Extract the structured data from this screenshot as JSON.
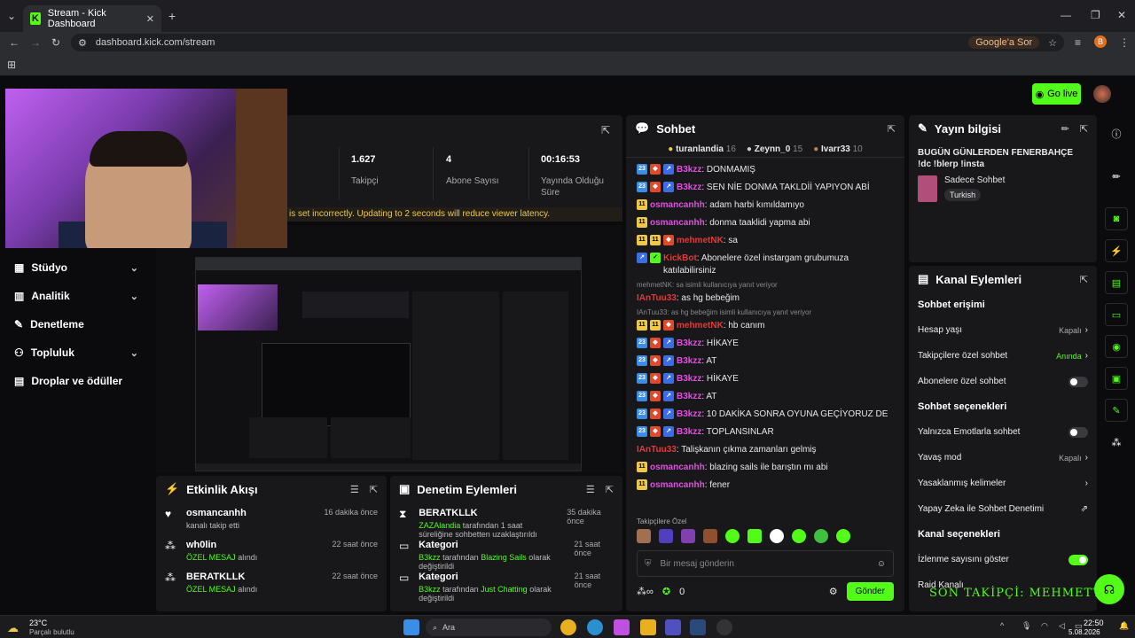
{
  "browser": {
    "tab_title": "Stream - Kick Dashboard",
    "url": "dashboard.kick.com/stream",
    "google_ask": "Google'a Sor",
    "profile_letter": "B"
  },
  "topbar": {
    "go_live": "Go live"
  },
  "stats": {
    "followers": "1.627",
    "followers_label": "Takipçi",
    "subs": "4",
    "subs_label": "Abone Sayısı",
    "uptime": "00:16:53",
    "uptime_label": "Yayında Olduğu Süre",
    "warning": "is set incorrectly. Updating to 2 seconds will reduce viewer latency."
  },
  "sidebar": {
    "items": [
      {
        "label": "Stüdyo"
      },
      {
        "label": "Analitik"
      },
      {
        "label": "Denetleme"
      },
      {
        "label": "Topluluk"
      },
      {
        "label": "Droplar ve ödüller"
      }
    ]
  },
  "activity": {
    "title": "Etkinlik Akışı",
    "events": [
      {
        "user": "osmancanhh",
        "desc": "kanalı takip etti",
        "time": "16 dakika önce"
      },
      {
        "user": "wh0lin",
        "desc_a": "ÖZEL MESAJ",
        "desc_b": "alındı",
        "time": "22 saat önce"
      },
      {
        "user": "BERATKLLK",
        "desc_a": "ÖZEL MESAJ",
        "desc_b": "alındı",
        "time": "22 saat önce"
      }
    ]
  },
  "moderation": {
    "title": "Denetim Eylemleri",
    "events": [
      {
        "user": "BERATKLLK",
        "actor": "ZAZAlandia",
        "desc": "tarafından 1 saat süreliğine sohbetten uzaklaştırıldı",
        "time": "35 dakika önce"
      },
      {
        "user": "Kategori",
        "actor": "B3kzz",
        "desc_a": "tarafından",
        "cat": "Blazing Sails",
        "desc_b": "olarak değiştirildi",
        "time": "21 saat önce"
      },
      {
        "user": "Kategori",
        "actor": "B3kzz",
        "desc_a": "tarafından",
        "cat": "Just Chatting",
        "desc_b": "olarak değiştirildi",
        "time": "21 saat önce"
      }
    ]
  },
  "chat": {
    "title": "Sohbet",
    "top_gifters": [
      {
        "name": "turanlandia",
        "count": "16"
      },
      {
        "name": "Zeynn_0",
        "count": "15"
      },
      {
        "name": "Ivarr33",
        "count": "10"
      }
    ],
    "messages": [
      {
        "user": "B3kzz",
        "color": "#e050e0",
        "text": "DONMAMIŞ",
        "badges": [
          "num",
          "mod",
          "vip"
        ]
      },
      {
        "user": "B3kzz",
        "color": "#e050e0",
        "text": "SEN NİE DONMA TAKLDİİ YAPIYON ABİ",
        "badges": [
          "num",
          "mod",
          "vip"
        ]
      },
      {
        "user": "osmancanhh",
        "color": "#e050e0",
        "text": "adam harbi kımıldamıyo",
        "badges": [
          "sub"
        ]
      },
      {
        "user": "osmancanhh",
        "color": "#e050e0",
        "text": "donma taaklidi yapma abi",
        "badges": [
          "sub"
        ]
      },
      {
        "user": "mehmetNK",
        "color": "#e03a3a",
        "text": "sa",
        "badges": [
          "sub",
          "sub",
          "mod"
        ]
      },
      {
        "user": "KickBot",
        "color": "#e03a3a",
        "text": "Abonelere özel instargam grubumuza katılabilirsiniz",
        "badges": [
          "vip",
          "og"
        ]
      },
      {
        "reply": "mehmetNK: sa isimli kullanıcıya yanıt veriyor",
        "user": "IAnTuu33",
        "color": "#e03a3a",
        "text": "as hg bebeğim",
        "badges": []
      },
      {
        "reply": "IAnTuu33: as hg bebeğim isimli kullanıcıya yanıt veriyor",
        "user": "mehmetNK",
        "color": "#e03a3a",
        "text": "hb canım",
        "badges": [
          "sub",
          "sub",
          "mod"
        ]
      },
      {
        "user": "B3kzz",
        "color": "#e050e0",
        "text": "HİKAYE",
        "badges": [
          "num",
          "mod",
          "vip"
        ]
      },
      {
        "user": "B3kzz",
        "color": "#e050e0",
        "text": "AT",
        "badges": [
          "num",
          "mod",
          "vip"
        ]
      },
      {
        "user": "B3kzz",
        "color": "#e050e0",
        "text": "HİKAYE",
        "badges": [
          "num",
          "mod",
          "vip"
        ]
      },
      {
        "user": "B3kzz",
        "color": "#e050e0",
        "text": "AT",
        "badges": [
          "num",
          "mod",
          "vip"
        ]
      },
      {
        "user": "B3kzz",
        "color": "#e050e0",
        "text": "10 DAKİKA SONRA OYUNA GEÇİYORUZ DE",
        "badges": [
          "num",
          "mod",
          "vip"
        ]
      },
      {
        "user": "B3kzz",
        "color": "#e050e0",
        "text": "TOPLANSINLAR",
        "badges": [
          "num",
          "mod",
          "vip"
        ]
      },
      {
        "user": "IAnTuu33",
        "color": "#e03a3a",
        "text": "Talişkanın çıkma zamanları gelmiş",
        "badges": []
      },
      {
        "user": "osmancanhh",
        "color": "#e050e0",
        "text": "blazing sails ile barıştın mı abi",
        "badges": [
          "sub"
        ]
      },
      {
        "user": "osmancanhh",
        "color": "#e050e0",
        "text": "fener",
        "badges": [
          "sub"
        ]
      }
    ],
    "emote_label": "Takipçilere Özel",
    "input_placeholder": "Bir mesaj gönderin",
    "points": "0",
    "send": "Gönder"
  },
  "info": {
    "title": "Yayın bilgisi",
    "stream_title": "BUGÜN GÜNLERDEN FENERBAHÇE !dc !blerp !insta",
    "category": "Sadece Sohbet",
    "language": "Turkish"
  },
  "actions": {
    "title": "Kanal Eylemleri",
    "chat_access": "Sohbet erişimi",
    "account_age": "Hesap yaşı",
    "account_age_val": "Kapalı",
    "followers_only": "Takipçilere özel sohbet",
    "followers_only_val": "Anında",
    "subs_only": "Abonelere özel sohbet",
    "chat_options": "Sohbet seçenekleri",
    "emote_only": "Yalnızca Emotlarla sohbet",
    "slow_mode": "Yavaş mod",
    "slow_mode_val": "Kapalı",
    "banned_words": "Yasaklanmış kelimeler",
    "ai_mod": "Yapay Zeka ile Sohbet Denetimi",
    "channel_options": "Kanal seçenekleri",
    "show_viewers": "İzlenme sayısını göster",
    "raid": "Raid Kanalı",
    "overlay": "SON TAKİPÇİ: MEHMETT30"
  },
  "taskbar": {
    "temp": "23°C",
    "weather": "Parçalı bulutlu",
    "search": "Ara",
    "time": "22:50",
    "date": "5.08.2026"
  }
}
